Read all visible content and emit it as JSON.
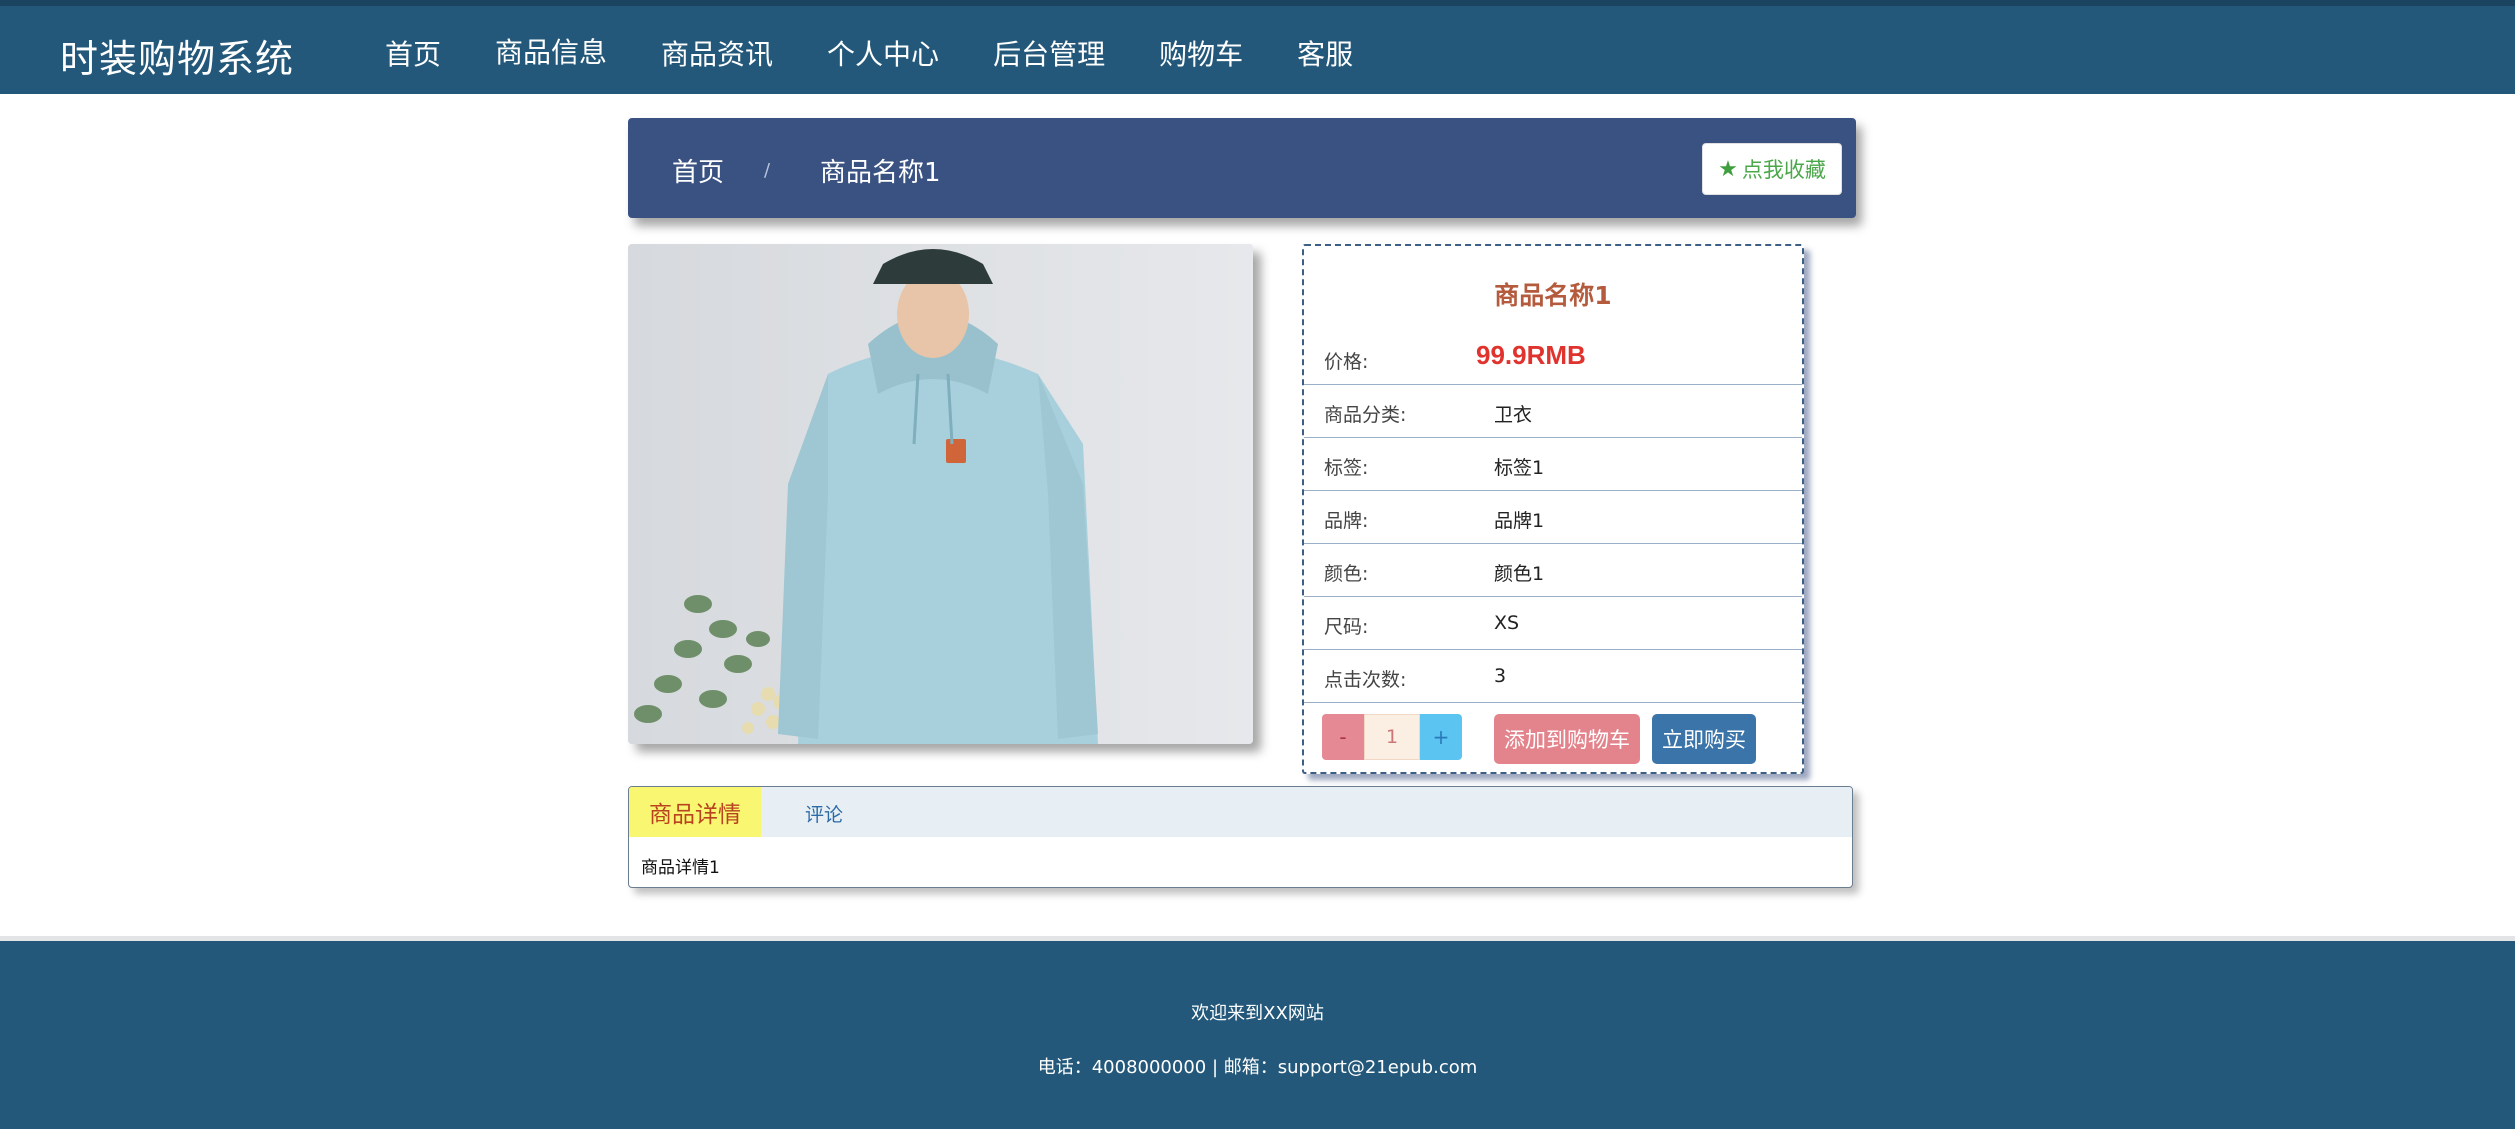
{
  "header": {
    "brand": "时装购物系统",
    "nav": [
      {
        "label": "首页",
        "active": false
      },
      {
        "label": "商品信息",
        "active": true
      },
      {
        "label": "商品资讯",
        "active": false
      },
      {
        "label": "个人中心",
        "active": false
      },
      {
        "label": "后台管理",
        "active": false
      },
      {
        "label": "购物车",
        "active": false
      },
      {
        "label": "客服",
        "active": false
      }
    ]
  },
  "breadcrumb": {
    "home": "首页",
    "separator": "/",
    "current": "商品名称1",
    "favorite_label": "点我收藏",
    "favorite_icon": "star-icon"
  },
  "product": {
    "name": "商品名称1",
    "price_label": "价格:",
    "price": "99.9RMB",
    "rows": [
      {
        "label": "商品分类:",
        "value": "卫衣"
      },
      {
        "label": "标签:",
        "value": "标签1"
      },
      {
        "label": "品牌:",
        "value": "品牌1"
      },
      {
        "label": "颜色:",
        "value": "颜色1"
      },
      {
        "label": "尺码:",
        "value": "XS"
      },
      {
        "label": "点击次数:",
        "value": "3"
      }
    ],
    "quantity": {
      "minus": "-",
      "value": "1",
      "plus": "+"
    },
    "add_to_cart": "添加到购物车",
    "buy_now": "立即购买"
  },
  "tabs": {
    "detail_label": "商品详情",
    "review_label": "评论",
    "content": "商品详情1"
  },
  "footer": {
    "line1": "欢迎来到XX网站",
    "line2": "电话：4008000000 | 邮箱：support@21epub.com"
  },
  "colors": {
    "header_bg": "#23587a",
    "crumb_bg": "#3a5282",
    "price": "#e0332e",
    "title": "#b55b3d"
  }
}
